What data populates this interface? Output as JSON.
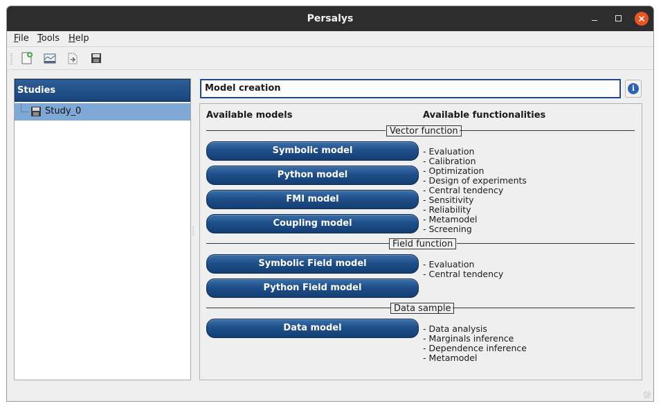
{
  "window": {
    "title": "Persalys",
    "accent": "#e95420"
  },
  "menu": [
    {
      "underline": "F",
      "rest": "ile"
    },
    {
      "underline": "T",
      "rest": "ools"
    },
    {
      "underline": "H",
      "rest": "elp"
    }
  ],
  "toolbar": {
    "icons": [
      "new-study-icon",
      "open-study-icon",
      "import-python-icon",
      "save-icon"
    ]
  },
  "studies": {
    "header": "Studies",
    "items": [
      {
        "label": "Study_0",
        "icon": "floppy-disk-icon",
        "selected": true
      }
    ]
  },
  "main": {
    "title": "Model creation",
    "info_icon": "i",
    "available_models": "Available models",
    "available_functionalities": "Available functionalities",
    "sections": [
      {
        "label": "Vector function",
        "models": [
          "Symbolic model",
          "Python model",
          "FMI model",
          "Coupling model"
        ],
        "functionalities": [
          "- Evaluation",
          "- Calibration",
          "- Optimization",
          "- Design of experiments",
          "- Central tendency",
          "- Sensitivity",
          "- Reliability",
          "- Metamodel",
          "- Screening"
        ]
      },
      {
        "label": "Field function",
        "models": [
          "Symbolic Field model",
          "Python Field model"
        ],
        "functionalities": [
          "- Evaluation",
          "- Central tendency"
        ]
      },
      {
        "label": "Data sample",
        "models": [
          "Data model"
        ],
        "functionalities": [
          "- Data analysis",
          "- Marginals inference",
          "- Dependence inference",
          "- Metamodel"
        ]
      }
    ]
  },
  "colors": {
    "header_blue": "#1d4a80",
    "selection": "#7ea8d5",
    "button_blue": "#1f4f8a"
  }
}
